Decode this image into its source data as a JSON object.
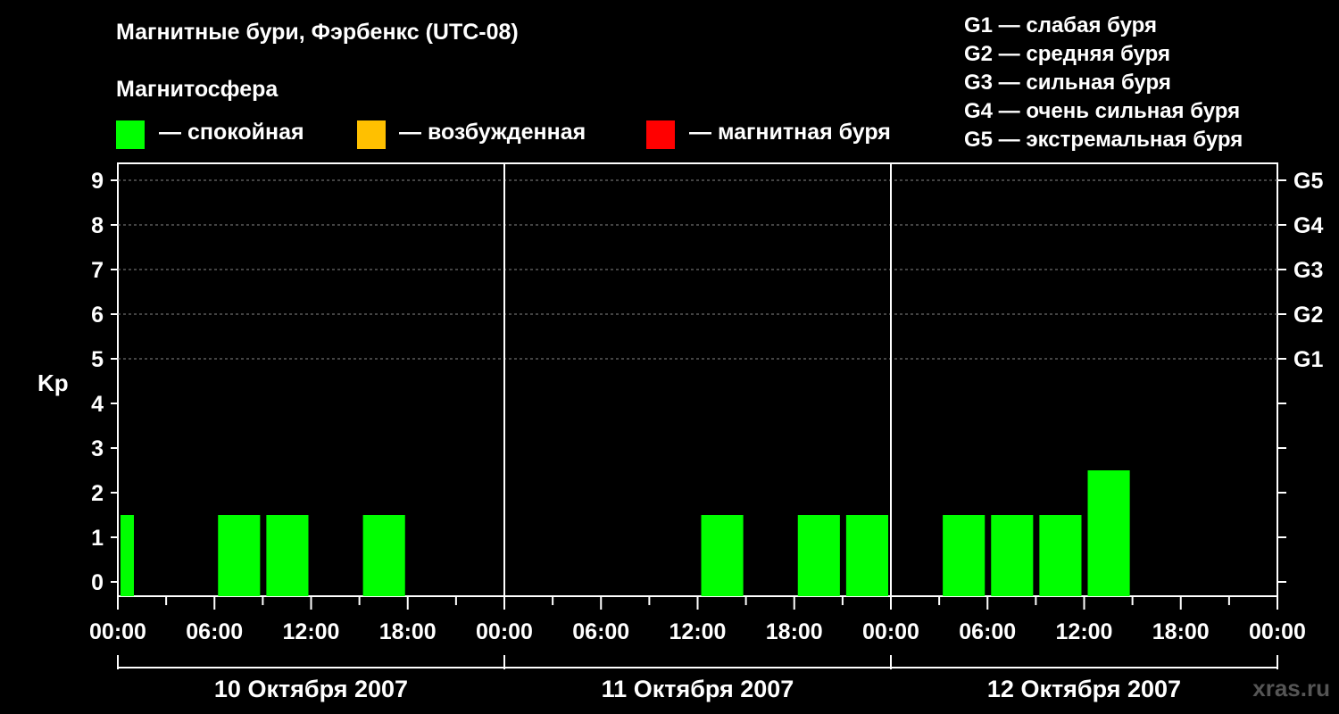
{
  "title": "Магнитные бури, Фэрбенкс (UTC-08)",
  "subtitle": "Магнитосфера",
  "legend": [
    {
      "label": "— спокойная",
      "color": "#00ff00"
    },
    {
      "label": "— возбужденная",
      "color": "#ffc000"
    },
    {
      "label": "— магнитная буря",
      "color": "#ff0000"
    }
  ],
  "g_scale": [
    "G1 — слабая буря",
    "G2 — средняя буря",
    "G3 — сильная буря",
    "G4 — очень сильная буря",
    "G5 — экстремальная буря"
  ],
  "watermark": "xras.ru",
  "chart_data": {
    "type": "bar",
    "ylabel": "Kp",
    "ylim": [
      0,
      9
    ],
    "yticks": [
      "0",
      "1",
      "2",
      "3",
      "4",
      "5",
      "6",
      "7",
      "8",
      "9"
    ],
    "right_ticks": [
      {
        "value": 5,
        "label": "G1"
      },
      {
        "value": 6,
        "label": "G2"
      },
      {
        "value": 7,
        "label": "G3"
      },
      {
        "value": 8,
        "label": "G4"
      },
      {
        "value": 9,
        "label": "G5"
      }
    ],
    "grid": "horizontal dashed at Kp 5-9",
    "xticks": [
      "00:00",
      "06:00",
      "12:00",
      "18:00",
      "00:00",
      "06:00",
      "12:00",
      "18:00",
      "00:00",
      "06:00",
      "12:00",
      "18:00",
      "00:00"
    ],
    "days": [
      "10 Октября 2007",
      "11 Октября 2007",
      "12 Октября 2007"
    ],
    "interval_hours": 3,
    "values": [
      1,
      0,
      1,
      1,
      0,
      1,
      0,
      0,
      0,
      0,
      0,
      0,
      1,
      0,
      1,
      1,
      0,
      1,
      1,
      1,
      2,
      0,
      0,
      0
    ],
    "first_bar_partial": true,
    "colors": {
      "quiet": "#00ff00",
      "active": "#ffc000",
      "storm": "#ff0000"
    }
  }
}
